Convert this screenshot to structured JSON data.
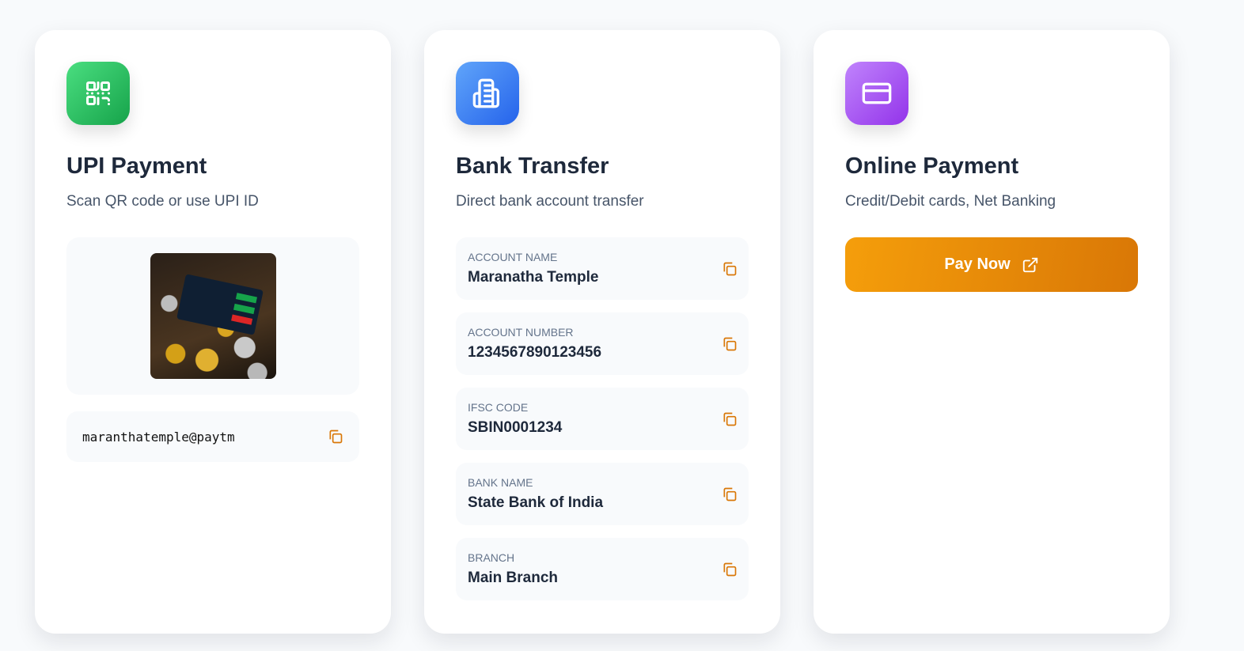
{
  "upi": {
    "title": "UPI Payment",
    "subtitle": "Scan QR code or use UPI ID",
    "upi_id": "maranthatemple@paytm",
    "icon": "qr-code-icon",
    "color": "#22c55e"
  },
  "bank": {
    "title": "Bank Transfer",
    "subtitle": "Direct bank account transfer",
    "icon": "building-icon",
    "color": "#3b82f6",
    "fields": [
      {
        "label": "Account Name",
        "value": "Maranatha Temple"
      },
      {
        "label": "Account Number",
        "value": "1234567890123456"
      },
      {
        "label": "IFSC Code",
        "value": "SBIN0001234"
      },
      {
        "label": "Bank Name",
        "value": "State Bank of India"
      },
      {
        "label": "Branch",
        "value": "Main Branch"
      }
    ]
  },
  "online": {
    "title": "Online Payment",
    "subtitle": "Credit/Debit cards, Net Banking",
    "button": "Pay Now",
    "icon": "credit-card-icon",
    "color": "#a855f7",
    "button_color": "#f59e0b"
  }
}
